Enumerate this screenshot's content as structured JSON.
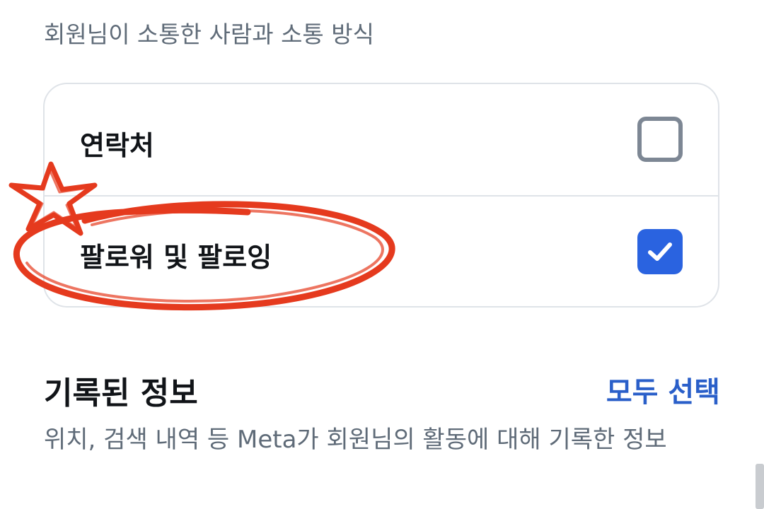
{
  "header": {
    "subtitle": "회원님이 소통한 사람과 소통 방식"
  },
  "options": [
    {
      "label": "연락처",
      "checked": false
    },
    {
      "label": "팔로워 및 팔로잉",
      "checked": true
    }
  ],
  "recorded_section": {
    "title": "기록된 정보",
    "select_all_label": "모두 선택",
    "description": "위치, 검색 내역 등 Meta가 회원님의 활동에 대해 기록한 정보"
  },
  "colors": {
    "accent": "#2a63e0",
    "link": "#2a5fc9",
    "annotation": "#e53a1e"
  }
}
